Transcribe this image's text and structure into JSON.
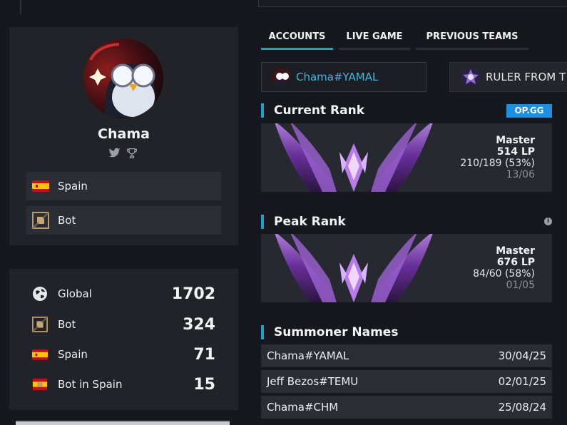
{
  "profile": {
    "name": "Chama",
    "country": "Spain",
    "role": "Bot"
  },
  "stats": [
    {
      "label": "Global",
      "value": "1702",
      "icon": "globe-icon"
    },
    {
      "label": "Bot",
      "value": "324",
      "icon": "bot-role-icon"
    },
    {
      "label": "Spain",
      "value": "71",
      "icon": "spain-flag-icon"
    },
    {
      "label": "Bot in Spain",
      "value": "15",
      "icon": "spain-bot-icon"
    }
  ],
  "tabs": [
    {
      "label": "ACCOUNTS",
      "active": true
    },
    {
      "label": "LIVE GAME",
      "active": false
    },
    {
      "label": "PREVIOUS TEAMS",
      "active": false
    }
  ],
  "accounts": [
    {
      "name": "Chama#YAMAL",
      "color": "#3cb9e3"
    },
    {
      "name": "RULER FROM T",
      "color": "#e6e7ea"
    }
  ],
  "current_rank": {
    "title": "Current Rank",
    "badge": "OP.GG",
    "tier": "Master",
    "lp": "514 LP",
    "record": "210/189 (53%)",
    "date": "13/06"
  },
  "peak_rank": {
    "title": "Peak Rank",
    "info": "i",
    "tier": "Master",
    "lp": "676 LP",
    "record": "84/60 (58%)",
    "date": "01/05"
  },
  "summoner_names": {
    "title": "Summoner Names",
    "rows": [
      {
        "name": "Chama#YAMAL",
        "date": "30/04/25"
      },
      {
        "name": "Jeff Bezos#TEMU",
        "date": "02/01/25"
      },
      {
        "name": "Chama#CHM",
        "date": "25/08/24"
      }
    ]
  },
  "colors": {
    "accent": "#17a3c7",
    "background": "#16181d",
    "card": "#212329",
    "opgg": "#1a8fe3",
    "master_purple": "#8a3fc9"
  }
}
